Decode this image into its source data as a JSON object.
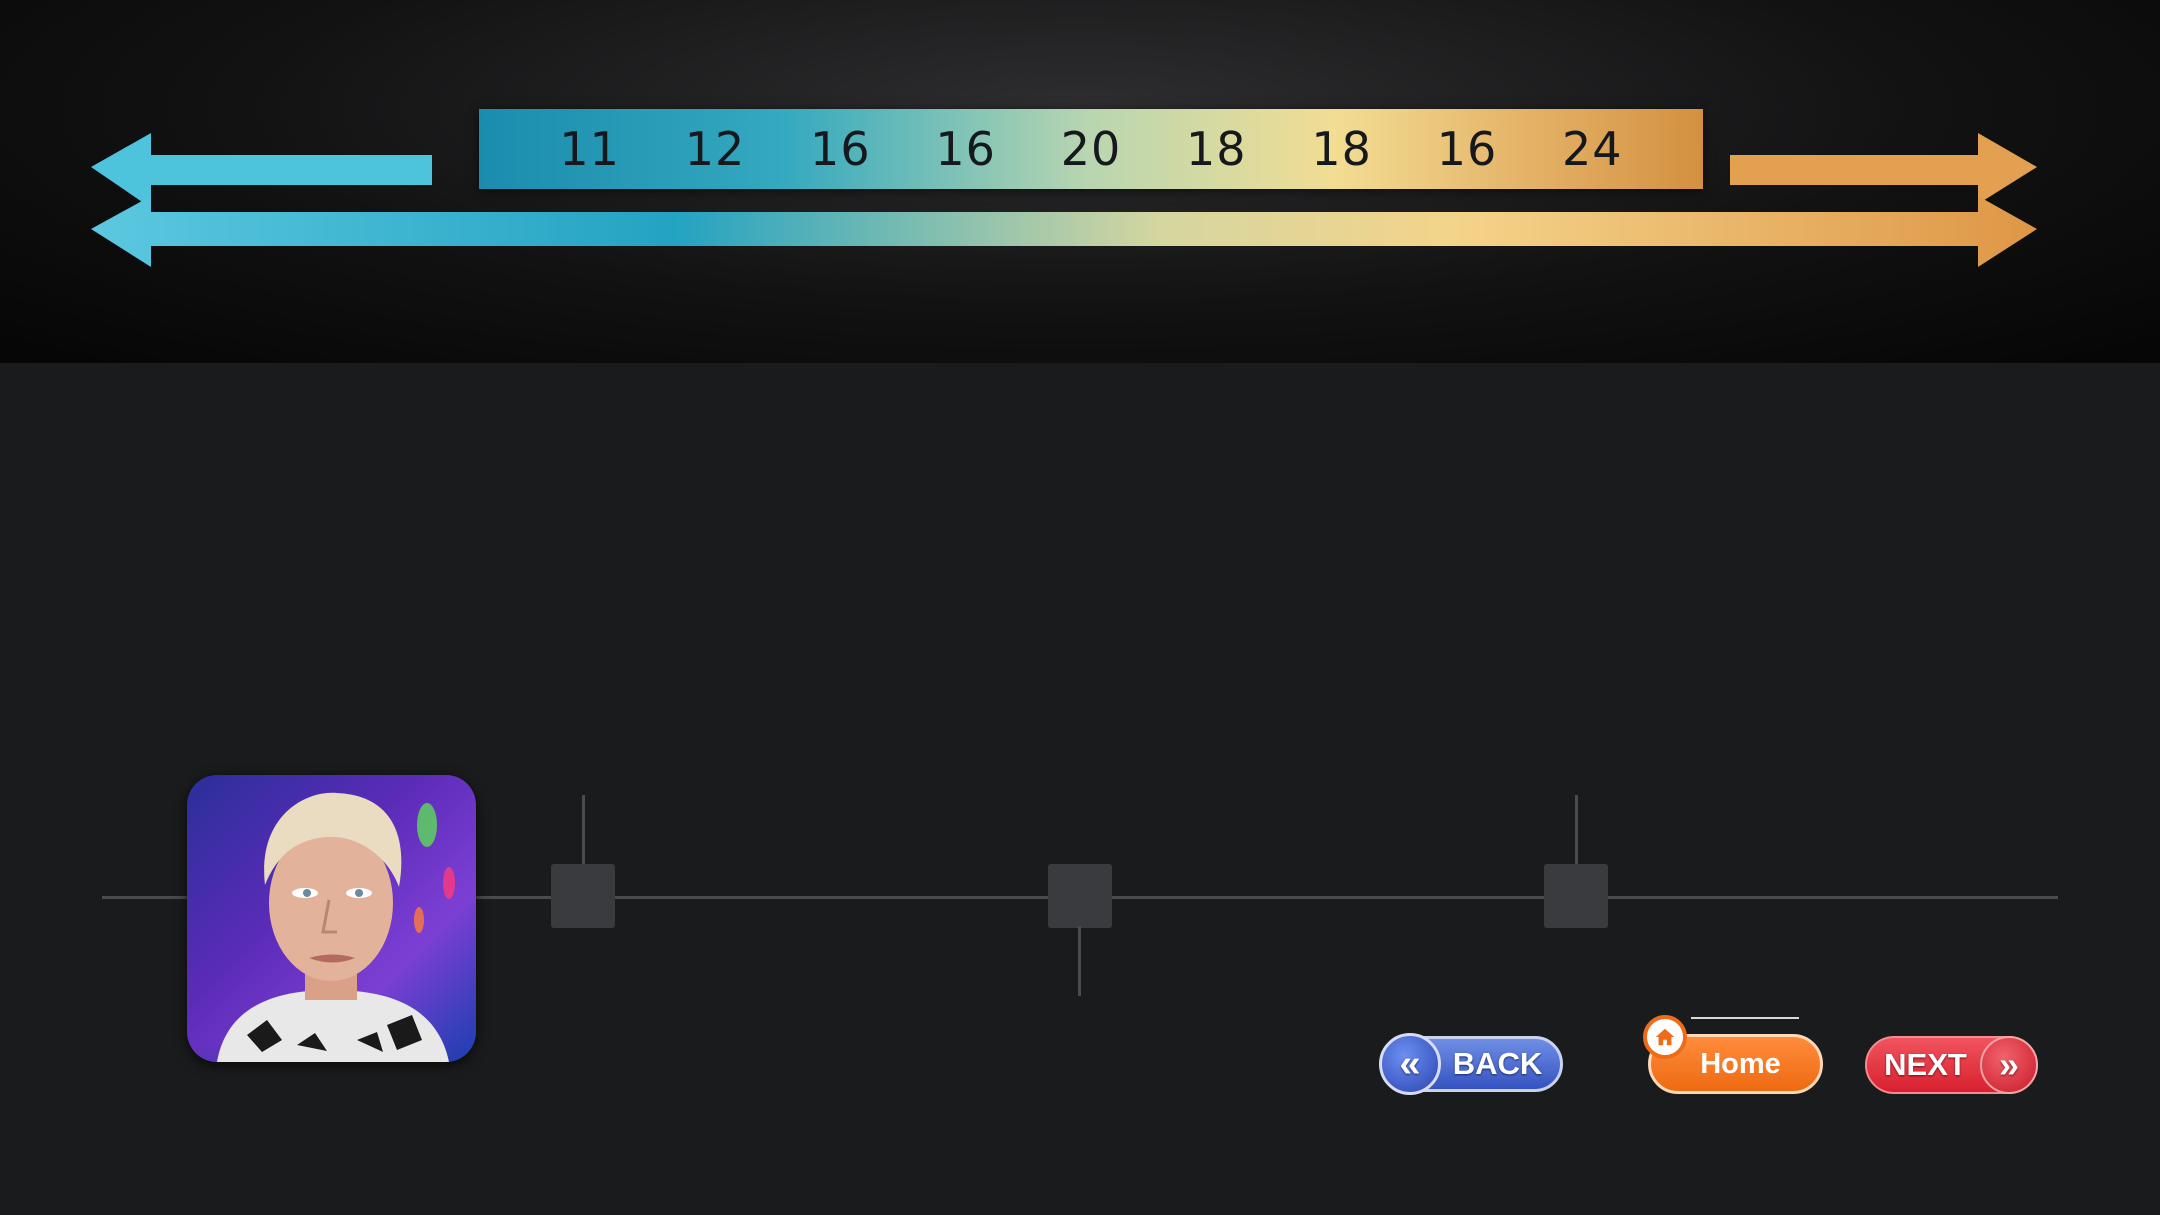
{
  "banner": {
    "numbers": [
      "11",
      "12",
      "16",
      "16",
      "20",
      "18",
      "18",
      "16",
      "24"
    ],
    "colors": {
      "left_arrow": "#4ec3dc",
      "right_arrow": "#e3a050"
    }
  },
  "timeline": {
    "nodes": 3
  },
  "avatar": {
    "alt": "profile-photo"
  },
  "navigation": {
    "back_label": "BACK",
    "back_icon": "chevron-double-left-icon",
    "home_label": "Home",
    "home_icon": "home-icon",
    "next_label": "NEXT",
    "next_icon": "chevron-double-right-icon",
    "colors": {
      "back": "#3a57c4",
      "home": "#f07420",
      "next": "#e02e3b"
    }
  }
}
